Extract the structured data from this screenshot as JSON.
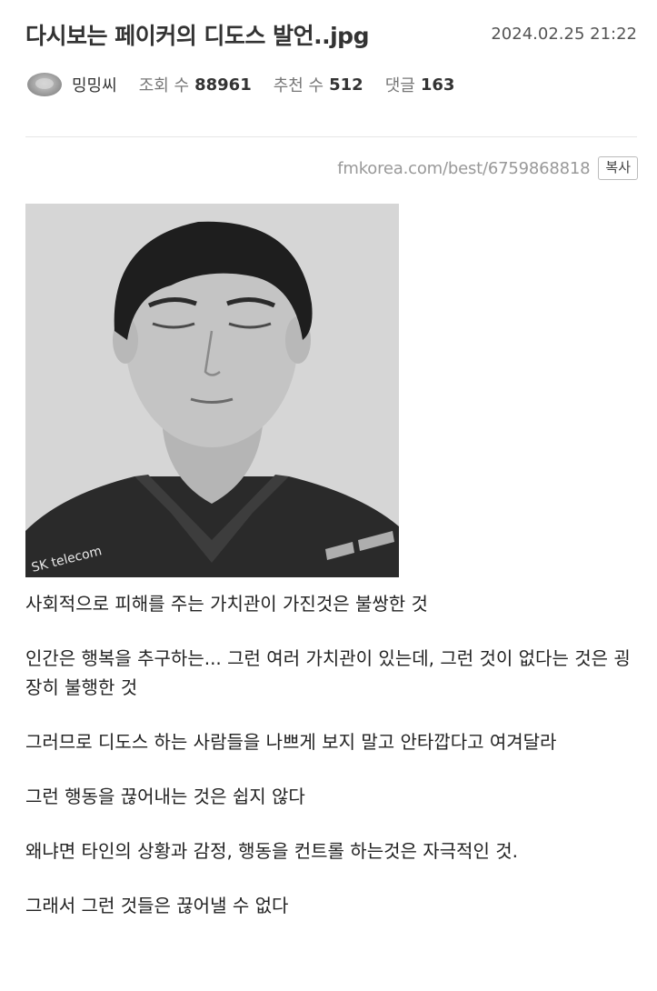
{
  "post": {
    "title": "다시보는 페이커의 디도스 발언..jpg",
    "date": "2024.02.25 21:22",
    "author": "밍밍씨",
    "views_label": "조회 수",
    "views": "88961",
    "recommend_label": "추천 수",
    "recommend": "512",
    "comments_label": "댓글",
    "comments": "163",
    "url": "fmkorea.com/best/6759868818",
    "copy_label": "복사"
  },
  "photo": {
    "jersey_text": "SK telecom",
    "colors": {
      "background": "#d8d8d8",
      "hair": "#1e1e1e",
      "skin": "#bdbdbd",
      "jersey": "#2a2a2a"
    }
  },
  "paragraphs": [
    "사회적으로 피해를 주는 가치관이 가진것은 불쌍한 것",
    "인간은 행복을 추구하는... 그런 여러 가치관이 있는데, 그런 것이 없다는 것은 굉장히 불행한 것",
    "그러므로 디도스 하는 사람들을 나쁘게 보지 말고 안타깝다고 여겨달라",
    "그런 행동을 끊어내는 것은 쉽지 않다",
    "왜냐면 타인의 상황과 감정, 행동을 컨트롤 하는것은 자극적인 것.",
    "그래서 그런 것들은 끊어낼 수 없다"
  ]
}
